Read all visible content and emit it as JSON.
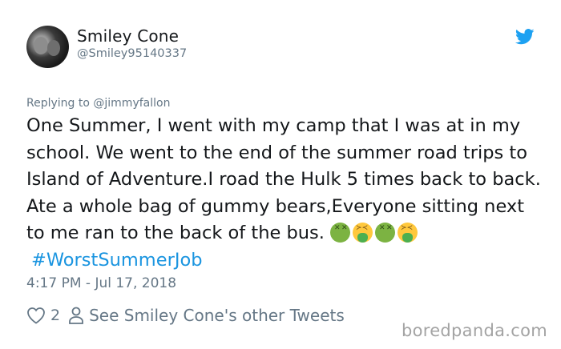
{
  "user": {
    "display_name": "Smiley Cone",
    "handle": "@Smiley95140337",
    "avatar_icon": "avatar-photo"
  },
  "reply_context": {
    "prefix": "Replying to ",
    "mention": "@jimmyfallon"
  },
  "tweet": {
    "text": "One Summer, I went with my camp that I was at in my school. We went to the end of the summer road trips to Island of Adventure.I road the Hulk 5 times back to back. Ate a whole bag of gummy bears,Everyone sitting next to me ran to the back of the bus.",
    "emojis": [
      "nauseated-face-icon",
      "face-vomiting-icon",
      "nauseated-face-icon",
      "face-vomiting-icon"
    ],
    "hashtag": "#WorstSummerJob",
    "timestamp": "4:17 PM - Jul 17, 2018"
  },
  "actions": {
    "like_count": "2",
    "other_tweets_label": "See Smiley Cone's other Tweets"
  },
  "watermark": "boredpanda.com",
  "colors": {
    "link": "#1b95e0",
    "secondary_text": "#657786",
    "primary_text": "#14171a",
    "twitter_blue": "#1da1f2"
  }
}
